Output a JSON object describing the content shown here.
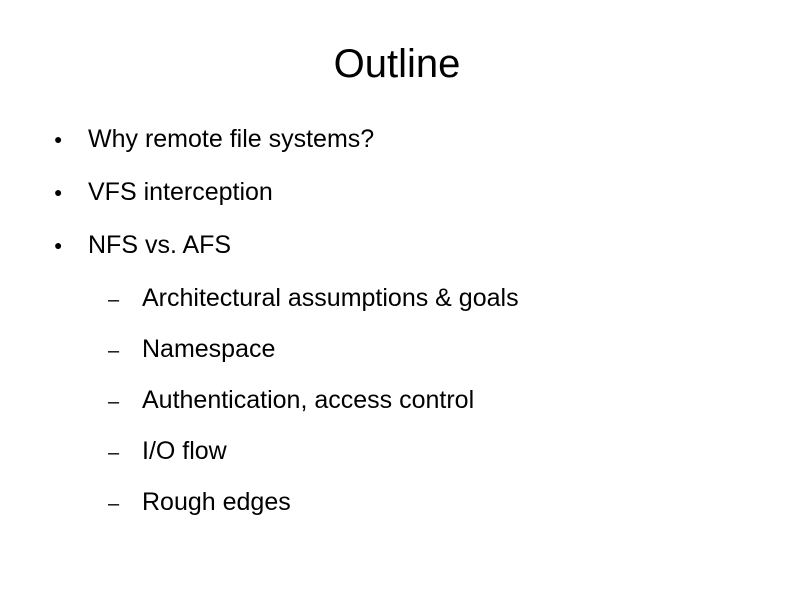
{
  "slide": {
    "title": "Outline",
    "bullets": [
      {
        "text": "Why remote file systems?"
      },
      {
        "text": "VFS interception"
      },
      {
        "text": "NFS vs. AFS"
      }
    ],
    "subbullets": [
      {
        "text": "Architectural assumptions & goals"
      },
      {
        "text": "Namespace"
      },
      {
        "text": "Authentication, access control"
      },
      {
        "text": "I/O flow"
      },
      {
        "text": "Rough edges"
      }
    ]
  }
}
